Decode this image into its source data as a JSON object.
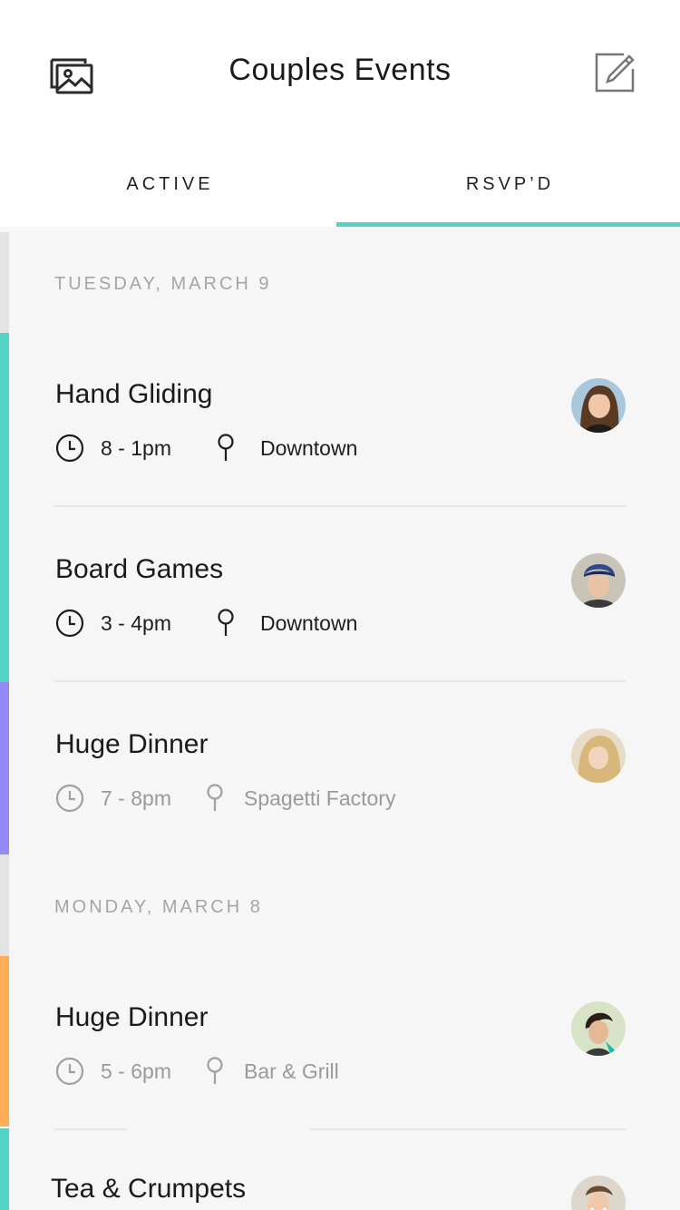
{
  "header": {
    "title": "Couples Events",
    "left_icon": "photo-gallery-icon",
    "right_icon": "compose-icon"
  },
  "tabs": [
    {
      "label": "ACTIVE",
      "selected": false
    },
    {
      "label": "RSVP’D",
      "selected": true
    }
  ],
  "colors": {
    "accent": "#53d3c5",
    "teal_stripe": "#53d3c5",
    "purple_stripe": "#9589f7",
    "orange_stripe": "#ffac55",
    "gray_stripe": "#e3e3e3"
  },
  "sections": [
    {
      "date": "TUESDAY, MARCH 9",
      "events": [
        {
          "title": "Hand Gliding",
          "time": "8 - 1pm",
          "location": "Downtown",
          "stripe": "teal",
          "avatar": "woman-brown-hair"
        },
        {
          "title": "Board Games",
          "time": "3 - 4pm",
          "location": "Downtown",
          "stripe": "teal",
          "avatar": "man-blue-cap"
        },
        {
          "title": "Huge Dinner",
          "time": "7 - 8pm",
          "location": "Spagetti Factory",
          "stripe": "purple",
          "avatar": "woman-blonde"
        }
      ]
    },
    {
      "date": "MONDAY, MARCH 8",
      "events": [
        {
          "title": "Huge Dinner",
          "time": "5 - 6pm",
          "location": "Bar & Grill",
          "stripe": "orange",
          "avatar": "woman-dark-hair"
        },
        {
          "title": "Tea & Crumpets",
          "time": "",
          "location": "",
          "stripe": "teal",
          "avatar": "man-smiling"
        }
      ]
    }
  ]
}
